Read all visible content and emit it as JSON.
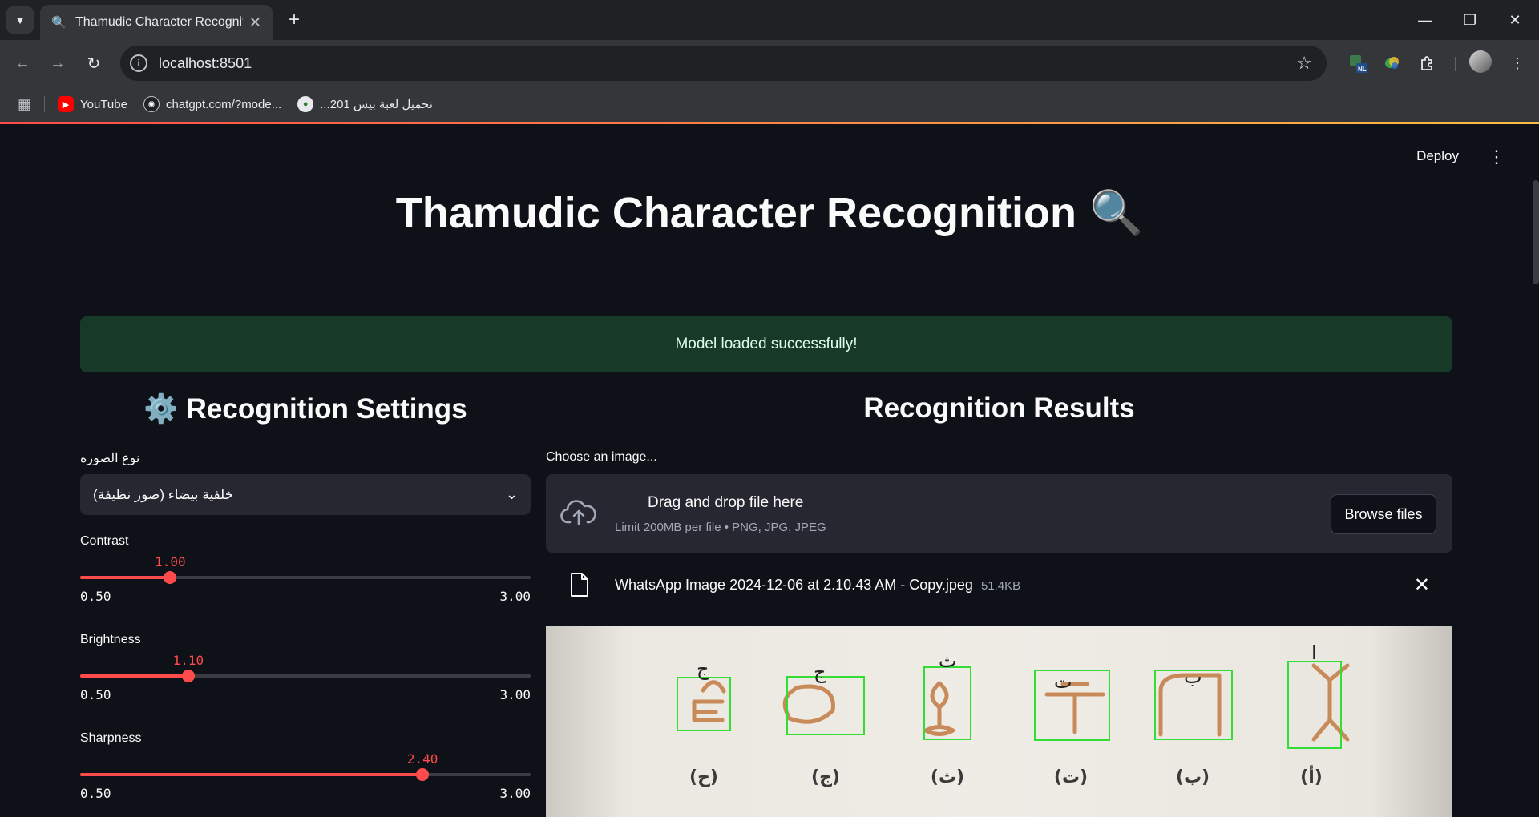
{
  "browser": {
    "tab_title": "Thamudic Character Recognition",
    "url": "localhost:8501",
    "bookmarks": [
      {
        "label": "YouTube",
        "icon": "youtube-icon"
      },
      {
        "label": "chatgpt.com/?mode...",
        "icon": "openai-icon"
      },
      {
        "label": "تحميل لعبة بيس 201...",
        "icon": "site-icon"
      }
    ]
  },
  "app": {
    "deploy_label": "Deploy",
    "title": "Thamudic Character Recognition",
    "title_icon": "🔍",
    "success_message": "Model loaded successfully!",
    "settings": {
      "heading": "Recognition Settings",
      "heading_icon": "⚙️",
      "image_type_label": "نوع الصوره",
      "image_type_value": "خلفية بيضاء (صور نظيفة)",
      "sliders": [
        {
          "label": "Contrast",
          "value": "1.00",
          "min": "0.50",
          "max": "3.00",
          "fraction": 0.2
        },
        {
          "label": "Brightness",
          "value": "1.10",
          "min": "0.50",
          "max": "3.00",
          "fraction": 0.24
        },
        {
          "label": "Sharpness",
          "value": "2.40",
          "min": "0.50",
          "max": "3.00",
          "fraction": 0.76
        }
      ]
    },
    "results": {
      "heading": "Recognition Results",
      "uploader_label": "Choose an image...",
      "drop_text": "Drag and drop file here",
      "limit_text": "Limit 200MB per file • PNG, JPG, JPEG",
      "browse_label": "Browse files",
      "file_name": "WhatsApp Image 2024-12-06 at 2.10.43 AM - Copy.jpeg",
      "file_size": "51.4KB",
      "characters": [
        {
          "predicted": "ج",
          "caption": "(ح)"
        },
        {
          "predicted": "ج",
          "caption": "(ج)"
        },
        {
          "predicted": "ث",
          "caption": "(ث)"
        },
        {
          "predicted": "ت",
          "caption": "(ت)"
        },
        {
          "predicted": "ب",
          "caption": "(ب)"
        },
        {
          "predicted": "ا",
          "caption": "(أ)"
        }
      ],
      "box_color": "#33dd33",
      "stroke_color": "#c98a5a"
    }
  }
}
